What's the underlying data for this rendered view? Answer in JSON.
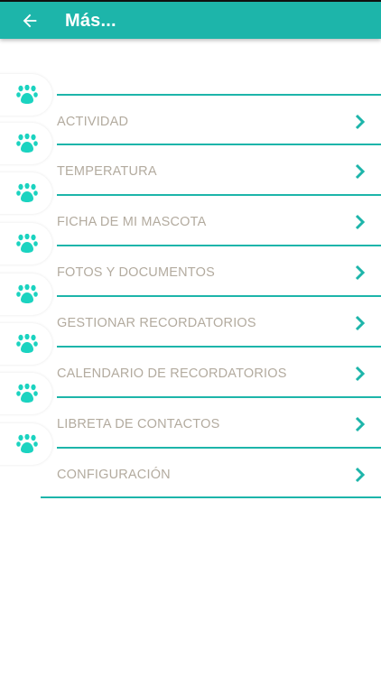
{
  "app_bar": {
    "title": "Más..."
  },
  "menu_items": [
    {
      "label": "ACTIVIDAD"
    },
    {
      "label": "TEMPERATURA"
    },
    {
      "label": "FICHA DE MI MASCOTA"
    },
    {
      "label": "FOTOS Y DOCUMENTOS"
    },
    {
      "label": "GESTIONAR RECORDATORIOS"
    },
    {
      "label": "CALENDARIO DE RECORDATORIOS"
    },
    {
      "label": "LIBRETA DE CONTACTOS"
    },
    {
      "label": "CONFIGURACIÓN"
    }
  ],
  "icons": {
    "back": "arrow-left-icon",
    "item_badge": "paw-icon",
    "item_chevron": "chevron-right-icon"
  },
  "colors": {
    "accent": "#1db5aa",
    "paw": "#1bd3c0",
    "label": "#b3ab9f",
    "background": "#ffffff"
  }
}
